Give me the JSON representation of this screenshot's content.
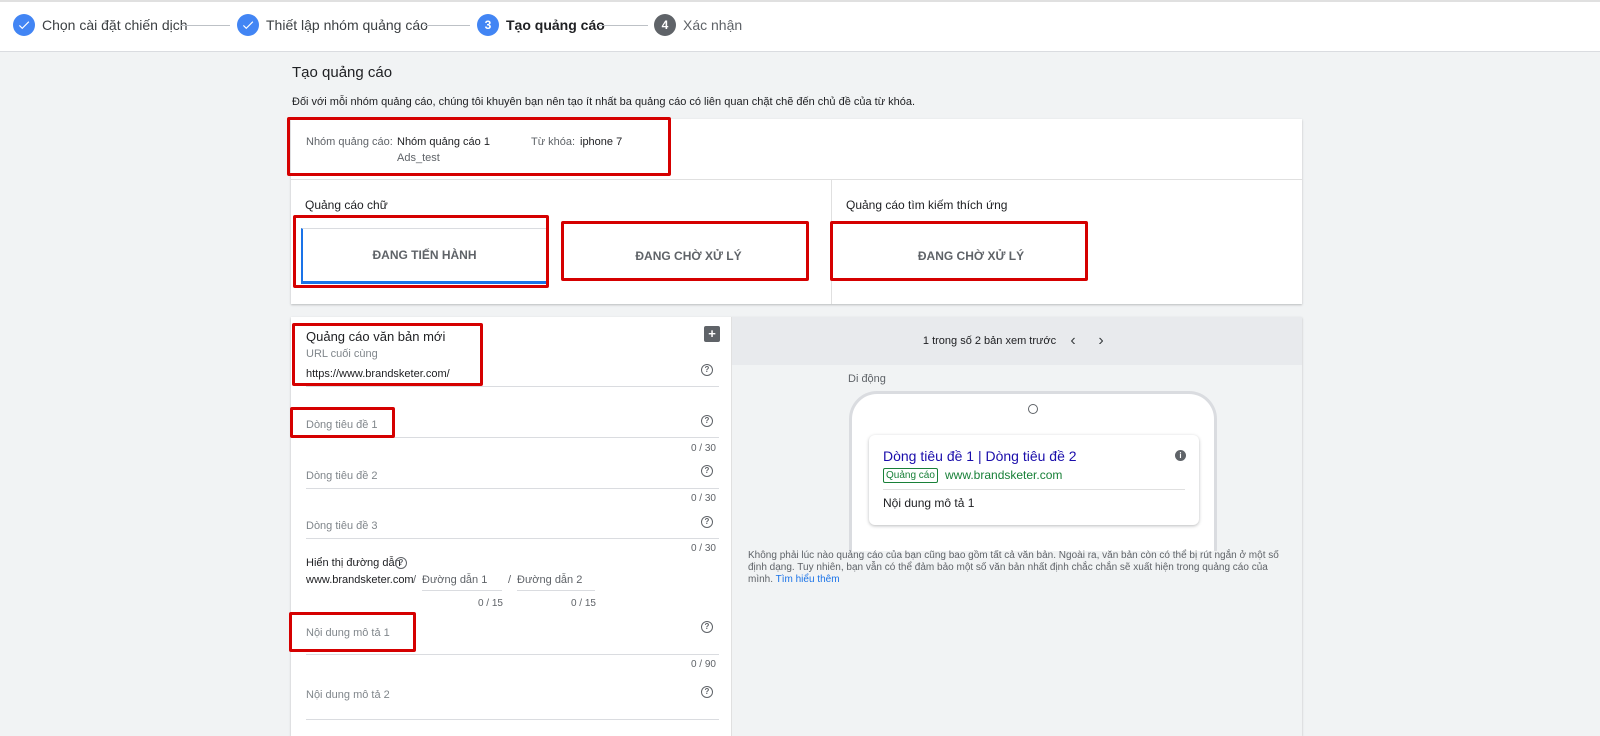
{
  "stepper": {
    "steps": [
      {
        "label": "Chọn cài đặt chiến dịch",
        "state": "done"
      },
      {
        "label": "Thiết lập nhóm quảng cáo",
        "state": "done"
      },
      {
        "number": "3",
        "label": "Tạo quảng cáo",
        "state": "current"
      },
      {
        "number": "4",
        "label": "Xác nhận",
        "state": "future"
      }
    ]
  },
  "page": {
    "title": "Tạo quảng cáo",
    "description": "Đối với mỗi nhóm quảng cáo, chúng tôi khuyên bạn nên tạo ít nhất ba quảng cáo có liên quan chặt chẽ đến chủ đề của từ khóa."
  },
  "ad_group": {
    "group_label": "Nhóm quảng cáo:",
    "group_name": "Nhóm quảng cáo 1",
    "campaign_name": "Ads_test",
    "keyword_label": "Từ khóa:",
    "keyword_value": "iphone 7"
  },
  "ad_types": {
    "text_ads_title": "Quảng cáo chữ",
    "responsive_title": "Quảng cáo tìm kiếm thích ứng",
    "text_ad_1_status": "ĐANG TIẾN HÀNH",
    "text_ad_2_status": "ĐANG CHỜ XỬ LÝ",
    "responsive_status": "ĐANG CHỜ XỬ LÝ"
  },
  "form": {
    "title": "Quảng cáo văn bản mới",
    "final_url_label": "URL cuối cùng",
    "final_url_value": "https://www.brandsketer.com/",
    "headline1_label": "Dòng tiêu đề 1",
    "headline1_counter": "0 / 30",
    "headline2_label": "Dòng tiêu đề 2",
    "headline2_counter": "0 / 30",
    "headline3_label": "Dòng tiêu đề 3",
    "headline3_counter": "0 / 30",
    "display_path_label": "Hiển thị đường dẫn",
    "display_domain": "www.brandsketer.com",
    "path_sep": "/",
    "path1_placeholder": "Đường dẫn 1",
    "path1_counter": "0 / 15",
    "path2_placeholder": "Đường dẫn 2",
    "path2_counter": "0 / 15",
    "desc1_label": "Nội dung mô tả 1",
    "desc1_counter": "0 / 90",
    "desc2_label": "Nội dung mô tả 2"
  },
  "preview": {
    "pager_text": "1 trong số 2 bản xem trước",
    "device_label": "Di động",
    "ad_headline": "Dòng tiêu đề 1 | Dòng tiêu đề 2",
    "ad_badge": "Quảng cáo",
    "ad_url": "www.brandsketer.com",
    "ad_description": "Nội dung mô tả 1",
    "note": "Không phải lúc nào quảng cáo của bạn cũng bao gồm tất cả văn bản. Ngoài ra, văn bản còn có thể bị rút ngắn ở một số định dạng. Tuy nhiên, bạn vẫn có thể đảm bảo một số văn bản nhất định chắc chắn sẽ xuất hiện trong quảng cáo của mình.",
    "learn_more": "Tìm hiểu thêm"
  },
  "icons": {
    "check": "check-icon",
    "help": "help-icon",
    "add_ad": "add-ad-icon",
    "info": "info-icon",
    "prev": "chevron-left-icon",
    "next": "chevron-right-icon"
  },
  "colors": {
    "accent": "#4285f4",
    "annotation": "#d50000",
    "ad_green": "#188038",
    "headline_blue": "#1a0dab"
  }
}
